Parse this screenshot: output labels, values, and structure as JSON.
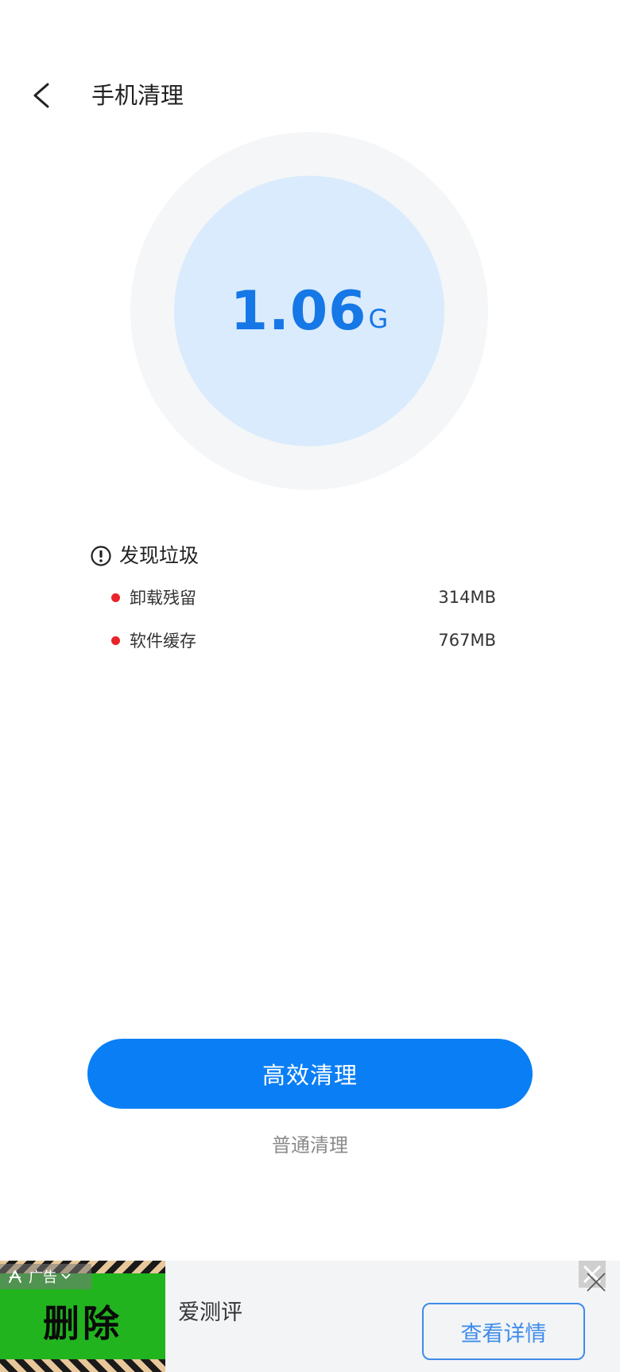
{
  "header": {
    "title": "手机清理",
    "back_icon": "chevron-left-icon"
  },
  "scan": {
    "size_value": "1.06",
    "size_unit": "G",
    "accent_color": "#1677e6"
  },
  "junk": {
    "title": "发现垃圾",
    "icon": "alert-circle-icon",
    "items": [
      {
        "label": "卸载残留",
        "value": "314MB"
      },
      {
        "label": "软件缓存",
        "value": "767MB"
      }
    ]
  },
  "actions": {
    "primary_label": "高效清理",
    "secondary_label": "普通清理",
    "primary_color": "#0a7ff5"
  },
  "ad": {
    "tag_label": "广告",
    "image_text": "删除",
    "app_name": "爱测评",
    "cta_label": "查看详情"
  }
}
